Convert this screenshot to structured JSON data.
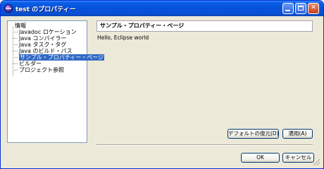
{
  "window": {
    "title": "test のプロパティー",
    "minimize_label": "_",
    "maximize_label": "□",
    "close_label": "✕"
  },
  "tree": {
    "items": [
      {
        "label": "情報"
      },
      {
        "label": "Javadoc ロケーション"
      },
      {
        "label": "Java コンパイラー"
      },
      {
        "label": "Java タスク・タグ"
      },
      {
        "label": "Java のビルド・パス"
      },
      {
        "label": "サンプル・プロパティー・ページ",
        "selected": true
      },
      {
        "label": "ビルダー"
      },
      {
        "label": "プロジェクト参照"
      }
    ]
  },
  "page": {
    "title": "サンプル・プロパティー・ページ",
    "content": "Hello, Eclipse world"
  },
  "buttons": {
    "restore_defaults": "デフォルトの復元(D)",
    "apply": "適用(A)",
    "ok": "OK",
    "cancel": "キャンセル"
  },
  "colors": {
    "titlebar": "#0753dc",
    "selection": "#316ac5",
    "dialog_bg": "#ece9d8"
  }
}
